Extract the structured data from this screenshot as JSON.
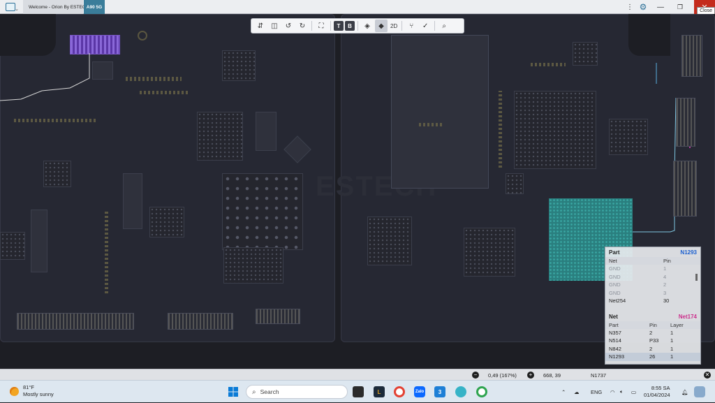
{
  "titlebar": {
    "tabs": [
      "Welcome - Orion By ESTECH",
      "A90 5G"
    ],
    "tooltip": "Close",
    "icons": [
      "app-icon",
      "more-icon",
      "settings-icon",
      "minimize-icon",
      "maximize-icon",
      "close-icon"
    ]
  },
  "toolbar": {
    "top_label": "T",
    "bottom_label": "B",
    "mode_label": "2D"
  },
  "canvas": {
    "watermark": "ESTECH"
  },
  "part_panel": {
    "title": "Part",
    "part_id": "N1293",
    "columns": [
      "Net",
      "Pin"
    ],
    "rows": [
      {
        "net": "GND",
        "pin": "1",
        "dim": true
      },
      {
        "net": "GND",
        "pin": "4",
        "dim": true
      },
      {
        "net": "GND",
        "pin": "2",
        "dim": true
      },
      {
        "net": "GND",
        "pin": "3",
        "dim": true
      },
      {
        "net": "Net254",
        "pin": "30",
        "dim": false
      }
    ]
  },
  "net_panel": {
    "title": "Net",
    "net_id": "Net174",
    "columns": [
      "Part",
      "Pin",
      "Layer"
    ],
    "rows": [
      {
        "part": "N357",
        "pin": "2",
        "layer": "1"
      },
      {
        "part": "N514",
        "pin": "P33",
        "layer": "1"
      },
      {
        "part": "N842",
        "pin": "2",
        "layer": "1"
      },
      {
        "part": "N1293",
        "pin": "26",
        "layer": "1"
      }
    ]
  },
  "statusbar": {
    "zoom": "0,49 (167%)",
    "coords": "668, 39",
    "selected": "N1737"
  },
  "taskbar": {
    "temperature": "81°F",
    "condition": "Mostly sunny",
    "search_label": "Search",
    "language": "ENG",
    "time": "8:55 SA",
    "date": "01/04/2024"
  }
}
